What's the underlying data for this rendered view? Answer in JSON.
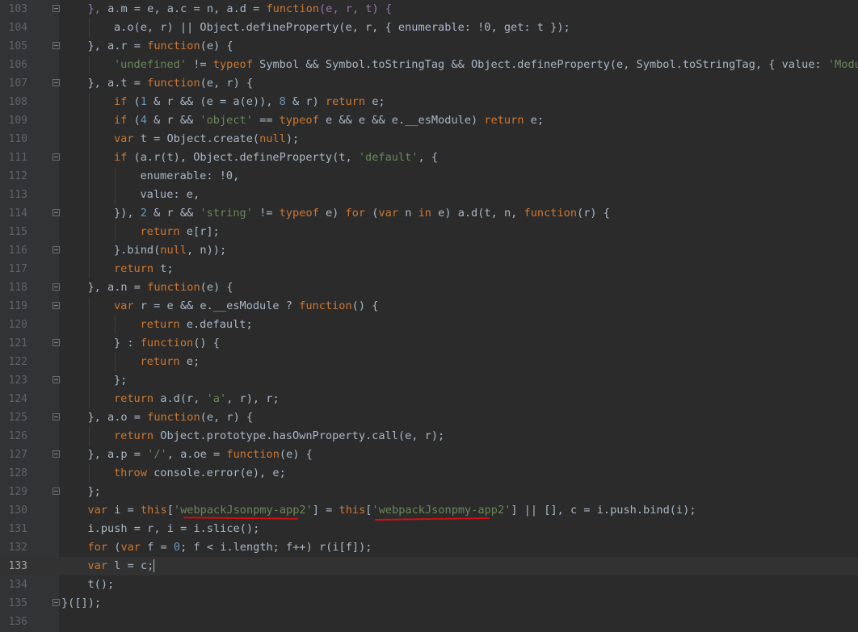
{
  "editor": {
    "lines": [
      {
        "n": "103",
        "indent": 1,
        "fold": true,
        "t": [
          [
            "p",
            "}, "
          ],
          [
            "",
            "a"
          ],
          [
            "p",
            "."
          ],
          [
            "",
            "m = e, a.c = n, a.d = "
          ],
          [
            "k",
            "function"
          ],
          [
            "p",
            "(e, r, t) {"
          ]
        ]
      },
      {
        "n": "104",
        "indent": 2,
        "fold": false,
        "t": [
          [
            "",
            "a.o(e, r) || Object.defineProperty(e, r, { enumerable: !0, get: t });"
          ]
        ]
      },
      {
        "n": "105",
        "indent": 1,
        "fold": true,
        "t": [
          [
            "",
            "}, a.r = "
          ],
          [
            "k",
            "function"
          ],
          [
            "",
            "(e) {"
          ]
        ]
      },
      {
        "n": "106",
        "indent": 2,
        "fold": false,
        "t": [
          [
            "s",
            "'undefined'"
          ],
          [
            "",
            " != "
          ],
          [
            "k",
            "typeof"
          ],
          [
            "",
            " Symbol && Symbol.toStringTag && Object.defineProperty(e, Symbol.toStringTag, { value: "
          ],
          [
            "s",
            "'Module"
          ]
        ]
      },
      {
        "n": "107",
        "indent": 1,
        "fold": true,
        "t": [
          [
            "",
            "}, a.t = "
          ],
          [
            "k",
            "function"
          ],
          [
            "",
            "(e, r) {"
          ]
        ]
      },
      {
        "n": "108",
        "indent": 2,
        "fold": false,
        "t": [
          [
            "k",
            "if"
          ],
          [
            "",
            " ("
          ],
          [
            "n",
            "1"
          ],
          [
            "",
            " & r && (e = a(e)), "
          ],
          [
            "n",
            "8"
          ],
          [
            "",
            " & r) "
          ],
          [
            "k",
            "return"
          ],
          [
            "",
            " e;"
          ]
        ]
      },
      {
        "n": "109",
        "indent": 2,
        "fold": false,
        "t": [
          [
            "k",
            "if"
          ],
          [
            "",
            " ("
          ],
          [
            "n",
            "4"
          ],
          [
            "",
            " & r && "
          ],
          [
            "s",
            "'object'"
          ],
          [
            "",
            " == "
          ],
          [
            "k",
            "typeof"
          ],
          [
            "",
            " e && e && e.__esModule) "
          ],
          [
            "k",
            "return"
          ],
          [
            "",
            " e;"
          ]
        ]
      },
      {
        "n": "110",
        "indent": 2,
        "fold": false,
        "t": [
          [
            "k",
            "var"
          ],
          [
            "",
            " t = Object.create("
          ],
          [
            "k",
            "null"
          ],
          [
            "",
            ");"
          ]
        ]
      },
      {
        "n": "111",
        "indent": 2,
        "fold": true,
        "t": [
          [
            "k",
            "if"
          ],
          [
            "",
            " (a.r(t), Object.defineProperty(t, "
          ],
          [
            "s",
            "'default'"
          ],
          [
            "",
            ", {"
          ]
        ]
      },
      {
        "n": "112",
        "indent": 3,
        "fold": false,
        "t": [
          [
            "",
            "enumerable: !0,"
          ]
        ]
      },
      {
        "n": "113",
        "indent": 3,
        "fold": false,
        "t": [
          [
            "",
            "value: e,"
          ]
        ]
      },
      {
        "n": "114",
        "indent": 2,
        "fold": true,
        "t": [
          [
            "",
            "}), "
          ],
          [
            "n",
            "2"
          ],
          [
            "",
            " & r && "
          ],
          [
            "s",
            "'string'"
          ],
          [
            "",
            " != "
          ],
          [
            "k",
            "typeof"
          ],
          [
            "",
            " e) "
          ],
          [
            "k",
            "for"
          ],
          [
            "",
            " ("
          ],
          [
            "k",
            "var"
          ],
          [
            "",
            " n "
          ],
          [
            "k",
            "in"
          ],
          [
            "",
            " e) a.d(t, n, "
          ],
          [
            "k",
            "function"
          ],
          [
            "",
            "(r) {"
          ]
        ]
      },
      {
        "n": "115",
        "indent": 3,
        "fold": false,
        "t": [
          [
            "k",
            "return"
          ],
          [
            "",
            " e[r];"
          ]
        ]
      },
      {
        "n": "116",
        "indent": 2,
        "fold": true,
        "t": [
          [
            "",
            "}.bind("
          ],
          [
            "k",
            "null"
          ],
          [
            "",
            ", n));"
          ]
        ]
      },
      {
        "n": "117",
        "indent": 2,
        "fold": false,
        "t": [
          [
            "k",
            "return"
          ],
          [
            "",
            " t;"
          ]
        ]
      },
      {
        "n": "118",
        "indent": 1,
        "fold": true,
        "t": [
          [
            "",
            "}, a.n = "
          ],
          [
            "k",
            "function"
          ],
          [
            "",
            "(e) {"
          ]
        ]
      },
      {
        "n": "119",
        "indent": 2,
        "fold": true,
        "t": [
          [
            "k",
            "var"
          ],
          [
            "",
            " r = e && e.__esModule ? "
          ],
          [
            "k",
            "function"
          ],
          [
            "",
            "() {"
          ]
        ]
      },
      {
        "n": "120",
        "indent": 3,
        "fold": false,
        "t": [
          [
            "k",
            "return"
          ],
          [
            "",
            " e.default;"
          ]
        ]
      },
      {
        "n": "121",
        "indent": 2,
        "fold": true,
        "t": [
          [
            "",
            "} : "
          ],
          [
            "k",
            "function"
          ],
          [
            "",
            "() {"
          ]
        ]
      },
      {
        "n": "122",
        "indent": 3,
        "fold": false,
        "t": [
          [
            "k",
            "return"
          ],
          [
            "",
            " e;"
          ]
        ]
      },
      {
        "n": "123",
        "indent": 2,
        "fold": true,
        "t": [
          [
            "",
            "};"
          ]
        ]
      },
      {
        "n": "124",
        "indent": 2,
        "fold": false,
        "t": [
          [
            "k",
            "return"
          ],
          [
            "",
            " a.d(r, "
          ],
          [
            "s",
            "'a'"
          ],
          [
            "",
            ", r), r;"
          ]
        ]
      },
      {
        "n": "125",
        "indent": 1,
        "fold": true,
        "t": [
          [
            "",
            "}, a.o = "
          ],
          [
            "k",
            "function"
          ],
          [
            "",
            "(e, r) {"
          ]
        ]
      },
      {
        "n": "126",
        "indent": 2,
        "fold": false,
        "t": [
          [
            "k",
            "return"
          ],
          [
            "",
            " Object.prototype.hasOwnProperty.call(e, r);"
          ]
        ]
      },
      {
        "n": "127",
        "indent": 1,
        "fold": true,
        "t": [
          [
            "",
            "}, a.p = "
          ],
          [
            "s",
            "'/'"
          ],
          [
            "",
            ", a.oe = "
          ],
          [
            "k",
            "function"
          ],
          [
            "",
            "(e) {"
          ]
        ]
      },
      {
        "n": "128",
        "indent": 2,
        "fold": false,
        "t": [
          [
            "k",
            "throw"
          ],
          [
            "",
            " console.error(e), e;"
          ]
        ]
      },
      {
        "n": "129",
        "indent": 1,
        "fold": true,
        "t": [
          [
            "",
            "};"
          ]
        ]
      },
      {
        "n": "130",
        "indent": 1,
        "fold": false,
        "t": [
          [
            "k",
            "var"
          ],
          [
            "",
            " i = "
          ],
          [
            "k",
            "this"
          ],
          [
            "",
            "["
          ],
          [
            "s",
            "'webpackJsonpmy-app2'"
          ],
          [
            "",
            "] = "
          ],
          [
            "k",
            "this"
          ],
          [
            "",
            "["
          ],
          [
            "s",
            "'webpackJsonpmy-app2'"
          ],
          [
            "",
            "] || [], c = i.push.bind(i);"
          ]
        ]
      },
      {
        "n": "131",
        "indent": 1,
        "fold": false,
        "t": [
          [
            "",
            "i.push = r, i = i.slice();"
          ]
        ]
      },
      {
        "n": "132",
        "indent": 1,
        "fold": false,
        "t": [
          [
            "k",
            "for"
          ],
          [
            "",
            " ("
          ],
          [
            "k",
            "var"
          ],
          [
            "",
            " f = "
          ],
          [
            "n",
            "0"
          ],
          [
            "",
            "; f < i.length; f++) r(i[f]);"
          ]
        ]
      },
      {
        "n": "133",
        "indent": 1,
        "fold": false,
        "current": true,
        "t": [
          [
            "k",
            "var"
          ],
          [
            "",
            " l = c;"
          ]
        ]
      },
      {
        "n": "134",
        "indent": 1,
        "fold": false,
        "t": [
          [
            "",
            "t();"
          ]
        ]
      },
      {
        "n": "135",
        "indent": 0,
        "fold": true,
        "t": [
          [
            "",
            "}([]);"
          ]
        ]
      },
      {
        "n": "136",
        "indent": 0,
        "fold": false,
        "t": []
      }
    ]
  },
  "colors": {
    "background": "#2b2b2b",
    "gutter": "#313335",
    "keyword": "#cc7832",
    "string": "#6a8759",
    "number": "#6897bb",
    "identifier": "#a9b7c6",
    "annotation": "#d01010"
  }
}
